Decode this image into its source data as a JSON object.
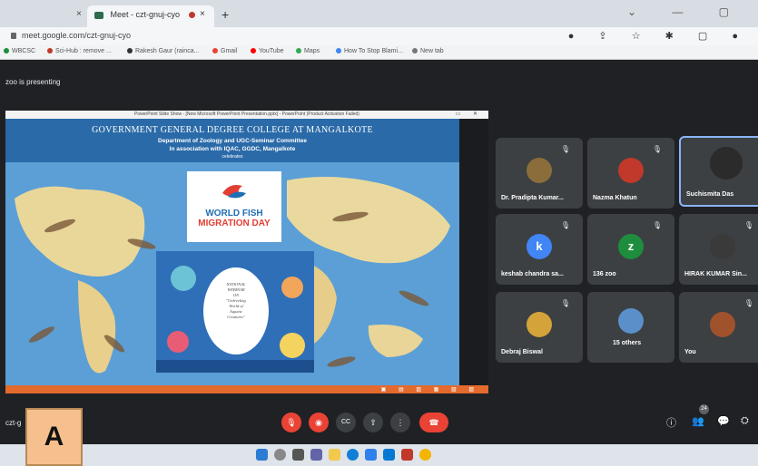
{
  "browser": {
    "prev_tab_close": "×",
    "tab_title": "Meet - czt-gnuj-cyo",
    "tab_close": "×",
    "new_tab": "+",
    "window_controls": "⌄ — ▢",
    "url": "meet.google.com/czt-gnuj-cyo",
    "addr_icons": "● ⇪ ☆ ✱ ▢ ●",
    "bookmarks": [
      "WBCSC",
      "Sci-Hub : remove ...",
      "Rakesh Gaur (rainca...",
      "Gmail",
      "YouTube",
      "Maps",
      "How To Stop Blami...",
      "New tab"
    ]
  },
  "meet": {
    "presenting": "zoo is presenting",
    "meet_code": "czt-g",
    "participant_count_badge": "24"
  },
  "slide": {
    "window_title": "PowerPoint Slide Show - [New Microsoft PowerPoint Presentation.pptx] - PowerPoint (Product Activation Failed)",
    "window_controls": "▭ ✕",
    "line1": "GOVERNMENT GENERAL DEGREE COLLEGE AT MANGALKOTE",
    "line2": "Department of Zoology and UGC-Seminar Committee",
    "line3": "In association with IQAC, GGDC, Mangalkote",
    "line4": "celebrates",
    "wfmd_line1": "WORLD FISH",
    "wfmd_line2": "MIGRATION DAY",
    "poster_text": [
      "NATIONAL",
      "WEBINAR",
      "ON",
      "\"Unleveling",
      "World of",
      "Aquatic",
      "Creatures\""
    ],
    "status_icons": "▣ ▤ ▥ ▦ ▧ ▨"
  },
  "participants": [
    {
      "name": "Dr. Pradipta Kumar...",
      "initial": "",
      "color": "#8a6d3b"
    },
    {
      "name": "Nazma Khatun",
      "initial": "",
      "color": "#c0392b"
    },
    {
      "name": "Suchismita Das",
      "initial": "",
      "color": "#2b2b2b"
    },
    {
      "name": "keshab chandra sa...",
      "initial": "k",
      "color": "#4285f4"
    },
    {
      "name": "136 zoo",
      "initial": "z",
      "color": "#1e8e3e"
    },
    {
      "name": "HIRAK KUMAR Sin...",
      "initial": "",
      "color": "#3a3a3a"
    },
    {
      "name": "Debraj Biswal",
      "initial": "",
      "color": "#d4a33a"
    },
    {
      "name": "15 others",
      "initial": "",
      "color": "#5b8fc9"
    },
    {
      "name": "You",
      "initial": "",
      "color": "#a0522d"
    }
  ],
  "mute_glyph": "🎙",
  "controls": {
    "mic": "🎙",
    "cam": "◉",
    "cc": "CC",
    "present": "⇧",
    "more": "⋮",
    "hangup": "☎",
    "info": "ⓘ",
    "people": "👥",
    "chat": "💬",
    "activities": "⛭"
  },
  "label": "A",
  "colors": {
    "accent": "#8ab4f8",
    "red": "#ea4335",
    "meet_bg": "#202124",
    "tile": "#3c4043"
  }
}
